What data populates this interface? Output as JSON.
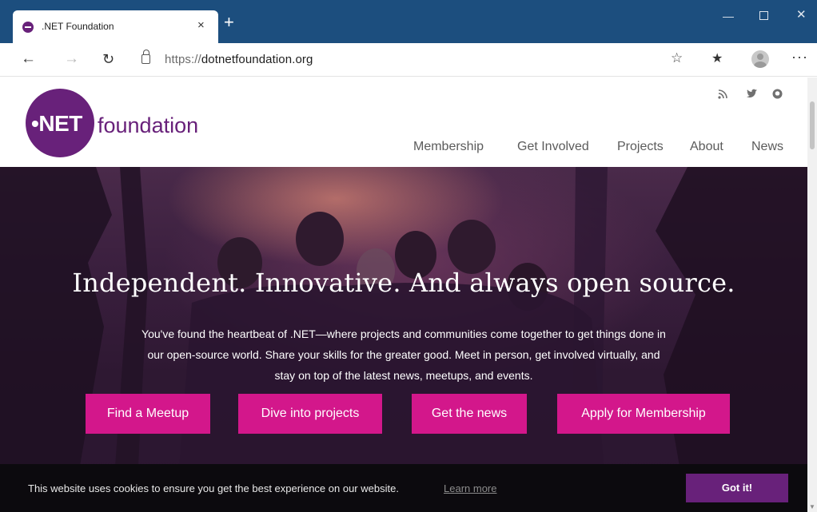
{
  "browser": {
    "tab": {
      "title": ".NET Foundation",
      "close": "×",
      "favicon_icon": "dotnet-favicon-icon"
    },
    "new_tab": "+",
    "window": {
      "minimize": "—",
      "close": "✕"
    },
    "nav": {
      "back": "←",
      "forward": "→",
      "refresh": "↻"
    },
    "url": {
      "scheme": "https://",
      "host": "dotnetfoundation.org"
    },
    "toolbar": {
      "favorite": "☆",
      "favorites_bar": "★",
      "more": "···"
    }
  },
  "site": {
    "logo": {
      "mark": "NET",
      "word": "foundation",
      "color": "#68217a"
    },
    "social": {
      "rss": "⊃",
      "twitter": "🐦",
      "github": "●"
    },
    "nav": [
      "Membership",
      "Get Involved",
      "Projects",
      "About",
      "News"
    ]
  },
  "hero": {
    "title": "Independent. Innovative. And always open source.",
    "description": "You've found the heartbeat of .NET—where projects and communities come together to get things done in our open-source world. Share your skills for the greater good. Meet in person, get involved virtually, and stay on top of the latest news, meetups, and events.",
    "buttons": [
      "Find a Meetup",
      "Dive into projects",
      "Get the news",
      "Apply for Membership"
    ],
    "button_color": "#d3178b"
  },
  "cookie": {
    "text": "This website uses cookies to ensure you get the best experience on our website.",
    "link": "Learn more",
    "button": "Got it!"
  },
  "colors": {
    "titlebar": "#1c4e7e",
    "brand_purple": "#68217a",
    "cta_pink": "#d3178b"
  }
}
